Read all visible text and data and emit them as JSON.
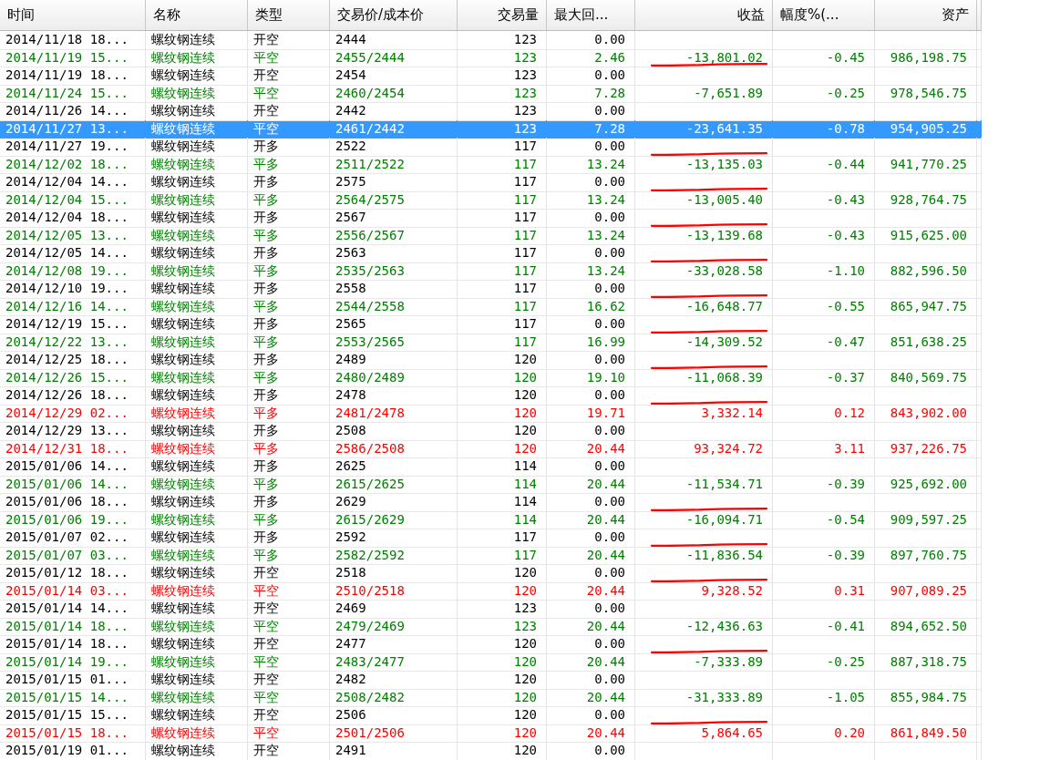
{
  "table": {
    "columns": [
      {
        "label": "时间"
      },
      {
        "label": "名称"
      },
      {
        "label": "类型"
      },
      {
        "label": "交易价/成本价"
      },
      {
        "label": "交易量"
      },
      {
        "label": "最大回..."
      },
      {
        "label": "收益"
      },
      {
        "label": "幅度%(..."
      },
      {
        "label": "资产"
      }
    ],
    "rows": [
      {
        "time": "2014/11/18 18...",
        "name": "螺纹钢连续",
        "type": "开空",
        "price": "2444",
        "qty": "123",
        "drawdown": "0.00",
        "color": "#000000",
        "selected": false,
        "underlined": false
      },
      {
        "time": "2014/11/19 15...",
        "name": "螺纹钢连续",
        "type": "平空",
        "price": "2455/2444",
        "qty": "123",
        "drawdown": "2.46",
        "profit": "-13,801.02",
        "pct": "-0.45",
        "assets": "986,198.75",
        "color": "#008000",
        "selected": false,
        "underlined": true
      },
      {
        "time": "2014/11/19 18...",
        "name": "螺纹钢连续",
        "type": "开空",
        "price": "2454",
        "qty": "123",
        "drawdown": "0.00",
        "color": "#000000",
        "selected": false,
        "underlined": false
      },
      {
        "time": "2014/11/24 15...",
        "name": "螺纹钢连续",
        "type": "平空",
        "price": "2460/2454",
        "qty": "123",
        "drawdown": "7.28",
        "profit": "-7,651.89",
        "pct": "-0.25",
        "assets": "978,546.75",
        "color": "#008000",
        "selected": false,
        "underlined": false
      },
      {
        "time": "2014/11/26 14...",
        "name": "螺纹钢连续",
        "type": "开空",
        "price": "2442",
        "qty": "123",
        "drawdown": "0.00",
        "color": "#000000",
        "selected": false,
        "underlined": false
      },
      {
        "time": "2014/11/27 13...",
        "name": "螺纹钢连续",
        "type": "平空",
        "price": "2461/2442",
        "qty": "123",
        "drawdown": "7.28",
        "profit": "-23,641.35",
        "pct": "-0.78",
        "assets": "954,905.25",
        "selected": true,
        "underlined": false
      },
      {
        "time": "2014/11/27 19...",
        "name": "螺纹钢连续",
        "type": "开多",
        "price": "2522",
        "qty": "117",
        "drawdown": "0.00",
        "color": "#000000",
        "selected": false,
        "underlined": true
      },
      {
        "time": "2014/12/02 18...",
        "name": "螺纹钢连续",
        "type": "平多",
        "price": "2511/2522",
        "qty": "117",
        "drawdown": "13.24",
        "profit": "-13,135.03",
        "pct": "-0.44",
        "assets": "941,770.25",
        "color": "#008000",
        "selected": false,
        "underlined": false
      },
      {
        "time": "2014/12/04 14...",
        "name": "螺纹钢连续",
        "type": "开多",
        "price": "2575",
        "qty": "117",
        "drawdown": "0.00",
        "color": "#000000",
        "selected": false,
        "underlined": true
      },
      {
        "time": "2014/12/04 15...",
        "name": "螺纹钢连续",
        "type": "平多",
        "price": "2564/2575",
        "qty": "117",
        "drawdown": "13.24",
        "profit": "-13,005.40",
        "pct": "-0.43",
        "assets": "928,764.75",
        "color": "#008000",
        "selected": false,
        "underlined": false
      },
      {
        "time": "2014/12/04 18...",
        "name": "螺纹钢连续",
        "type": "开多",
        "price": "2567",
        "qty": "117",
        "drawdown": "0.00",
        "color": "#000000",
        "selected": false,
        "underlined": true
      },
      {
        "time": "2014/12/05 13...",
        "name": "螺纹钢连续",
        "type": "平多",
        "price": "2556/2567",
        "qty": "117",
        "drawdown": "13.24",
        "profit": "-13,139.68",
        "pct": "-0.43",
        "assets": "915,625.00",
        "color": "#008000",
        "selected": false,
        "underlined": false
      },
      {
        "time": "2014/12/05 14...",
        "name": "螺纹钢连续",
        "type": "开多",
        "price": "2563",
        "qty": "117",
        "drawdown": "0.00",
        "color": "#000000",
        "selected": false,
        "underlined": true
      },
      {
        "time": "2014/12/08 19...",
        "name": "螺纹钢连续",
        "type": "平多",
        "price": "2535/2563",
        "qty": "117",
        "drawdown": "13.24",
        "profit": "-33,028.58",
        "pct": "-1.10",
        "assets": "882,596.50",
        "color": "#008000",
        "selected": false,
        "underlined": false
      },
      {
        "time": "2014/12/10 19...",
        "name": "螺纹钢连续",
        "type": "开多",
        "price": "2558",
        "qty": "117",
        "drawdown": "0.00",
        "color": "#000000",
        "selected": false,
        "underlined": true
      },
      {
        "time": "2014/12/16 14...",
        "name": "螺纹钢连续",
        "type": "平多",
        "price": "2544/2558",
        "qty": "117",
        "drawdown": "16.62",
        "profit": "-16,648.77",
        "pct": "-0.55",
        "assets": "865,947.75",
        "color": "#008000",
        "selected": false,
        "underlined": false
      },
      {
        "time": "2014/12/19 15...",
        "name": "螺纹钢连续",
        "type": "开多",
        "price": "2565",
        "qty": "117",
        "drawdown": "0.00",
        "color": "#000000",
        "selected": false,
        "underlined": true
      },
      {
        "time": "2014/12/22 13...",
        "name": "螺纹钢连续",
        "type": "平多",
        "price": "2553/2565",
        "qty": "117",
        "drawdown": "16.99",
        "profit": "-14,309.52",
        "pct": "-0.47",
        "assets": "851,638.25",
        "color": "#008000",
        "selected": false,
        "underlined": false
      },
      {
        "time": "2014/12/25 18...",
        "name": "螺纹钢连续",
        "type": "开多",
        "price": "2489",
        "qty": "120",
        "drawdown": "0.00",
        "color": "#000000",
        "selected": false,
        "underlined": true
      },
      {
        "time": "2014/12/26 15...",
        "name": "螺纹钢连续",
        "type": "平多",
        "price": "2480/2489",
        "qty": "120",
        "drawdown": "19.10",
        "profit": "-11,068.39",
        "pct": "-0.37",
        "assets": "840,569.75",
        "color": "#008000",
        "selected": false,
        "underlined": false
      },
      {
        "time": "2014/12/26 18...",
        "name": "螺纹钢连续",
        "type": "开多",
        "price": "2478",
        "qty": "120",
        "drawdown": "0.00",
        "color": "#000000",
        "selected": false,
        "underlined": true
      },
      {
        "time": "2014/12/29 02...",
        "name": "螺纹钢连续",
        "type": "平多",
        "price": "2481/2478",
        "qty": "120",
        "drawdown": "19.71",
        "profit": "3,332.14",
        "pct": "0.12",
        "assets": "843,902.00",
        "color": "#ff0000",
        "selected": false,
        "underlined": false
      },
      {
        "time": "2014/12/29 13...",
        "name": "螺纹钢连续",
        "type": "开多",
        "price": "2508",
        "qty": "120",
        "drawdown": "0.00",
        "color": "#000000",
        "selected": false,
        "underlined": false
      },
      {
        "time": "2014/12/31 18...",
        "name": "螺纹钢连续",
        "type": "平多",
        "price": "2586/2508",
        "qty": "120",
        "drawdown": "20.44",
        "profit": "93,324.72",
        "pct": "3.11",
        "assets": "937,226.75",
        "color": "#ff0000",
        "selected": false,
        "underlined": false
      },
      {
        "time": "2015/01/06 14...",
        "name": "螺纹钢连续",
        "type": "开多",
        "price": "2625",
        "qty": "114",
        "drawdown": "0.00",
        "color": "#000000",
        "selected": false,
        "underlined": false
      },
      {
        "time": "2015/01/06 14...",
        "name": "螺纹钢连续",
        "type": "平多",
        "price": "2615/2625",
        "qty": "114",
        "drawdown": "20.44",
        "profit": "-11,534.71",
        "pct": "-0.39",
        "assets": "925,692.00",
        "color": "#008000",
        "selected": false,
        "underlined": false
      },
      {
        "time": "2015/01/06 18...",
        "name": "螺纹钢连续",
        "type": "开多",
        "price": "2629",
        "qty": "114",
        "drawdown": "0.00",
        "color": "#000000",
        "selected": false,
        "underlined": true
      },
      {
        "time": "2015/01/06 19...",
        "name": "螺纹钢连续",
        "type": "平多",
        "price": "2615/2629",
        "qty": "114",
        "drawdown": "20.44",
        "profit": "-16,094.71",
        "pct": "-0.54",
        "assets": "909,597.25",
        "color": "#008000",
        "selected": false,
        "underlined": false
      },
      {
        "time": "2015/01/07 02...",
        "name": "螺纹钢连续",
        "type": "开多",
        "price": "2592",
        "qty": "117",
        "drawdown": "0.00",
        "color": "#000000",
        "selected": false,
        "underlined": true
      },
      {
        "time": "2015/01/07 03...",
        "name": "螺纹钢连续",
        "type": "平多",
        "price": "2582/2592",
        "qty": "117",
        "drawdown": "20.44",
        "profit": "-11,836.54",
        "pct": "-0.39",
        "assets": "897,760.75",
        "color": "#008000",
        "selected": false,
        "underlined": false
      },
      {
        "time": "2015/01/12 18...",
        "name": "螺纹钢连续",
        "type": "开空",
        "price": "2518",
        "qty": "120",
        "drawdown": "0.00",
        "color": "#000000",
        "selected": false,
        "underlined": true
      },
      {
        "time": "2015/01/14 03...",
        "name": "螺纹钢连续",
        "type": "平空",
        "price": "2510/2518",
        "qty": "120",
        "drawdown": "20.44",
        "profit": "9,328.52",
        "pct": "0.31",
        "assets": "907,089.25",
        "color": "#ff0000",
        "selected": false,
        "underlined": false
      },
      {
        "time": "2015/01/14 14...",
        "name": "螺纹钢连续",
        "type": "开空",
        "price": "2469",
        "qty": "123",
        "drawdown": "0.00",
        "color": "#000000",
        "selected": false,
        "underlined": false
      },
      {
        "time": "2015/01/14 18...",
        "name": "螺纹钢连续",
        "type": "平空",
        "price": "2479/2469",
        "qty": "123",
        "drawdown": "20.44",
        "profit": "-12,436.63",
        "pct": "-0.41",
        "assets": "894,652.50",
        "color": "#008000",
        "selected": false,
        "underlined": false
      },
      {
        "time": "2015/01/14 18...",
        "name": "螺纹钢连续",
        "type": "开空",
        "price": "2477",
        "qty": "120",
        "drawdown": "0.00",
        "color": "#000000",
        "selected": false,
        "underlined": true
      },
      {
        "time": "2015/01/14 19...",
        "name": "螺纹钢连续",
        "type": "平空",
        "price": "2483/2477",
        "qty": "120",
        "drawdown": "20.44",
        "profit": "-7,333.89",
        "pct": "-0.25",
        "assets": "887,318.75",
        "color": "#008000",
        "selected": false,
        "underlined": false
      },
      {
        "time": "2015/01/15 01...",
        "name": "螺纹钢连续",
        "type": "开空",
        "price": "2482",
        "qty": "120",
        "drawdown": "0.00",
        "color": "#000000",
        "selected": false,
        "underlined": false
      },
      {
        "time": "2015/01/15 14...",
        "name": "螺纹钢连续",
        "type": "平空",
        "price": "2508/2482",
        "qty": "120",
        "drawdown": "20.44",
        "profit": "-31,333.89",
        "pct": "-1.05",
        "assets": "855,984.75",
        "color": "#008000",
        "selected": false,
        "underlined": false
      },
      {
        "time": "2015/01/15 15...",
        "name": "螺纹钢连续",
        "type": "开空",
        "price": "2506",
        "qty": "120",
        "drawdown": "0.00",
        "color": "#000000",
        "selected": false,
        "underlined": true
      },
      {
        "time": "2015/01/15 18...",
        "name": "螺纹钢连续",
        "type": "平空",
        "price": "2501/2506",
        "qty": "120",
        "drawdown": "20.44",
        "profit": "5,864.65",
        "pct": "0.20",
        "assets": "861,849.50",
        "color": "#ff0000",
        "selected": false,
        "underlined": false
      },
      {
        "time": "2015/01/19 01...",
        "name": "螺纹钢连续",
        "type": "开空",
        "price": "2491",
        "qty": "120",
        "drawdown": "0.00",
        "color": "#000000",
        "selected": false,
        "underlined": false
      }
    ]
  }
}
